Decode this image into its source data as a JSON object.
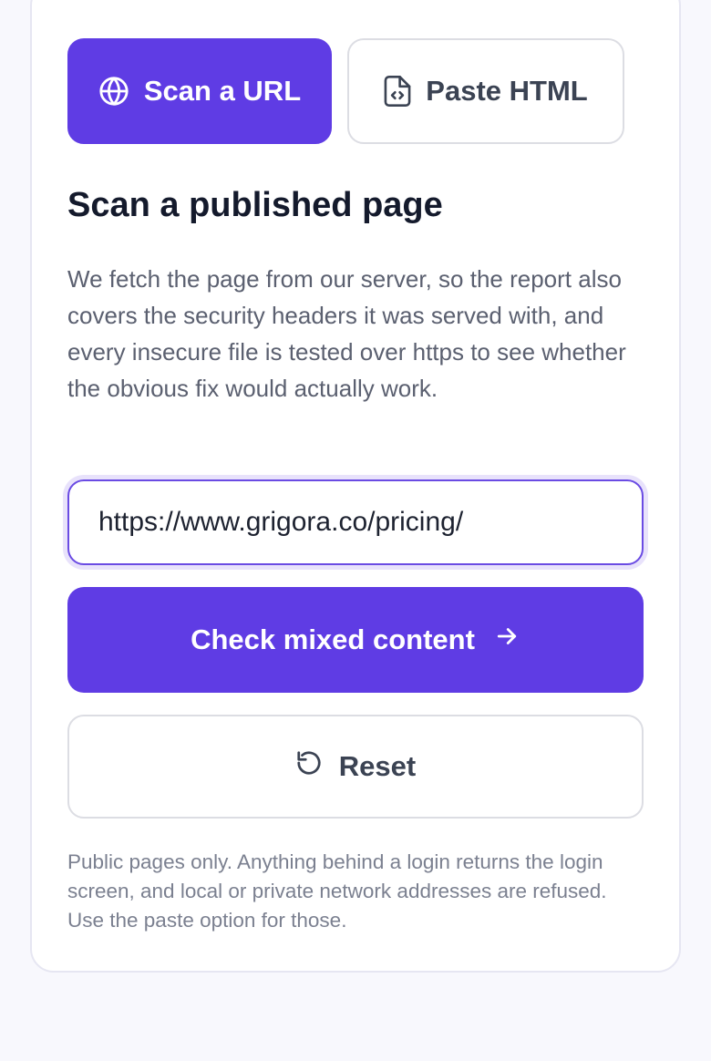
{
  "tabs": {
    "scan_url": {
      "label": "Scan a URL",
      "icon": "globe-icon"
    },
    "paste_html": {
      "label": "Paste HTML",
      "icon": "code-file-icon"
    }
  },
  "main": {
    "heading": "Scan a published page",
    "description": "We fetch the page from our server, so the report also covers the security headers it was served with, and every insecure file is tested over https to see whether the obvious fix would actually work."
  },
  "form": {
    "url_value": "https://www.grigora.co/pricing/",
    "submit_label": "Check mixed content",
    "submit_icon": "arrow-right-icon",
    "reset_label": "Reset",
    "reset_icon": "reset-icon"
  },
  "footer": {
    "note": "Public pages only. Anything behind a login returns the login screen, and local or private network addresses are refused. Use the paste option for those."
  },
  "colors": {
    "accent": "#5f3ce4",
    "heading": "#141a2c",
    "body_text": "#5b6070",
    "muted_text": "#7b8090",
    "border": "#dcdde3",
    "page_bg": "#f8f8fd"
  }
}
